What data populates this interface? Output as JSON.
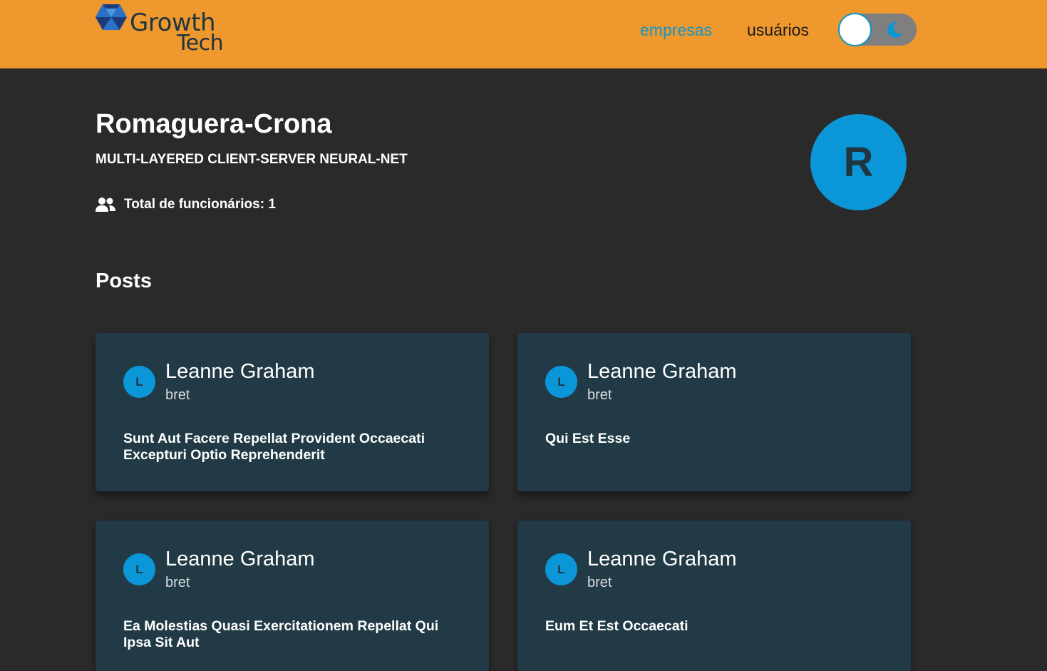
{
  "header": {
    "logo": {
      "line1": "Growth",
      "line2": "Tech"
    },
    "nav": [
      {
        "label": "empresas",
        "active": true
      },
      {
        "label": "usuários",
        "active": false
      }
    ],
    "theme_toggle": {
      "icon": "moon-icon",
      "mode": "dark"
    }
  },
  "company": {
    "name": "Romaguera-Crona",
    "catchphrase": "MULTI-LAYERED CLIENT-SERVER NEURAL-NET",
    "employees_label": "Total de funcionários: 1",
    "avatar_initial": "R"
  },
  "posts": {
    "heading": "Posts",
    "items": [
      {
        "avatar_initial": "L",
        "author": "Leanne Graham",
        "username": "bret",
        "title": "Sunt Aut Facere Repellat Provident Occaecati Excepturi Optio Reprehenderit"
      },
      {
        "avatar_initial": "L",
        "author": "Leanne Graham",
        "username": "bret",
        "title": "Qui Est Esse"
      },
      {
        "avatar_initial": "L",
        "author": "Leanne Graham",
        "username": "bret",
        "title": "Ea Molestias Quasi Exercitationem Repellat Qui Ipsa Sit Aut"
      },
      {
        "avatar_initial": "L",
        "author": "Leanne Graham",
        "username": "bret",
        "title": "Eum Et Est Occaecati"
      }
    ]
  },
  "colors": {
    "header_bg": "#ee982d",
    "page_bg": "#2a2a2a",
    "card_bg": "#213a45",
    "accent": "#0b96d7",
    "dark_text": "#1f3540"
  }
}
